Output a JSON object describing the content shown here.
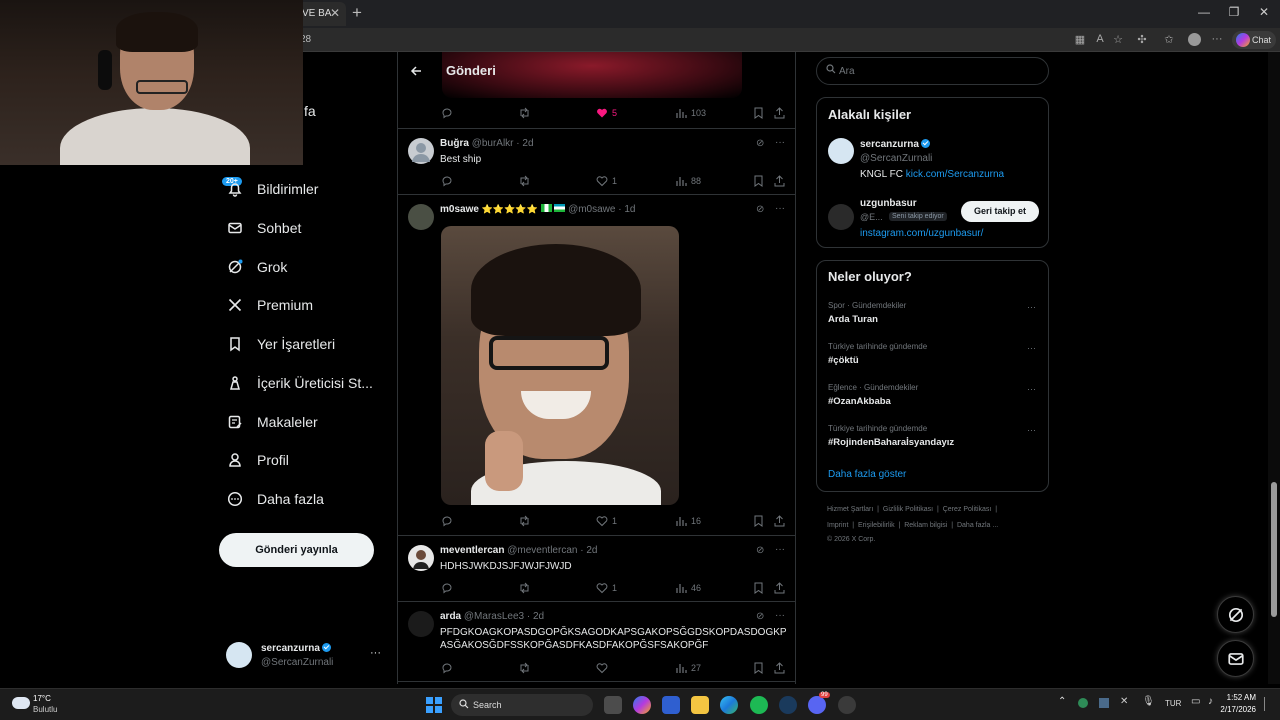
{
  "browser": {
    "tab_title": "VE BA",
    "url_fragment": "28",
    "chat_label": "Chat"
  },
  "nav": {
    "partial_item": "fa",
    "notification_badge": "20+",
    "items": [
      {
        "label": "Bildirimler",
        "icon": "bell-icon"
      },
      {
        "label": "Sohbet",
        "icon": "envelope-icon"
      },
      {
        "label": "Grok",
        "icon": "grok-icon"
      },
      {
        "label": "Premium",
        "icon": "x-logo-icon"
      },
      {
        "label": "Yer İşaretleri",
        "icon": "bookmark-icon"
      },
      {
        "label": "İçerik Üreticisi St...",
        "icon": "creator-studio-icon"
      },
      {
        "label": "Makaleler",
        "icon": "article-icon"
      },
      {
        "label": "Profil",
        "icon": "person-icon"
      },
      {
        "label": "Daha fazla",
        "icon": "more-circle-icon"
      }
    ],
    "post_button": "Gönderi yayınla",
    "account": {
      "name": "sercanzurna",
      "handle": "@SercanZurnali",
      "more": "···"
    }
  },
  "center": {
    "header_title": "Gönderi",
    "top_stats": {
      "likes": "5",
      "views": "103"
    },
    "posts": [
      {
        "name": "Buğra",
        "handle": "@burAlkr · 2d",
        "text": "Best ship",
        "replies": "",
        "reposts": "",
        "likes": "1",
        "views": "88"
      },
      {
        "name": "m0sawe",
        "emoji": "⭐⭐⭐⭐⭐",
        "handle": "@m0sawe · 1d",
        "text": "",
        "likes": "1",
        "views": "16"
      },
      {
        "name": "meventlercan",
        "handle": "@meventlercan · 2d",
        "text": "HDHSJWKDJSJFJWJFJWJD",
        "likes": "1",
        "views": "46"
      },
      {
        "name": "arda",
        "handle": "@MarasLee3 · 2d",
        "text": "PFDGKOAGKOPASDGOPĞKSAGODKAPSGAKOPSĞGDSKOPDASDOGKPASĞAKOSĞDFSSKOPĞASDFKASDFAKOPĞSFSAKOPĞF",
        "likes": "",
        "views": "27"
      }
    ]
  },
  "right": {
    "search_placeholder": "Ara",
    "related_title": "Alakalı kişiler",
    "related": [
      {
        "name": "sercanzurna",
        "handle": "@SercanZurnali",
        "bio_prefix": "KNGL FC ",
        "bio_link": "kick.com/Sercanzurna"
      },
      {
        "name": "uzgunbasur",
        "handle": "@E...",
        "follows_you": "Seni takip ediyor",
        "follow_back": "Geri takip et",
        "bio_link": "instagram.com/uzgunbasur/"
      }
    ],
    "trends_title": "Neler oluyor?",
    "trends": [
      {
        "category": "Spor · Gündemdekiler",
        "name": "Arda Turan"
      },
      {
        "category": "Türkiye tarihinde gündemde",
        "name": "#çöktü"
      },
      {
        "category": "Eğlence · Gündemdekiler",
        "name": "#OzanAkbaba"
      },
      {
        "category": "Türkiye tarihinde gündemde",
        "name": "#RojindenBaharaİsyandayız"
      }
    ],
    "show_more": "Daha fazla göster",
    "footer": {
      "l1a": "Hizmet Şartları",
      "l1b": "Gizlilik Politikası",
      "l1c": "Çerez Politikası",
      "l2a": "Imprint",
      "l2b": "Erişilebilirlik",
      "l2c": "Reklam bilgisi",
      "l2d": "Daha fazla ...",
      "copyright": "© 2026 X Corp."
    }
  },
  "taskbar": {
    "weather_temp": "17°C",
    "weather_desc": "Bulutlu",
    "search": "Search",
    "lang": "TUR",
    "time": "1:52 AM",
    "date": "2/17/2026",
    "discord_badge": "99"
  },
  "colors": {
    "accent": "#1d9bf0",
    "like": "#f91880",
    "bg": "#000000",
    "border": "#2f3336"
  }
}
